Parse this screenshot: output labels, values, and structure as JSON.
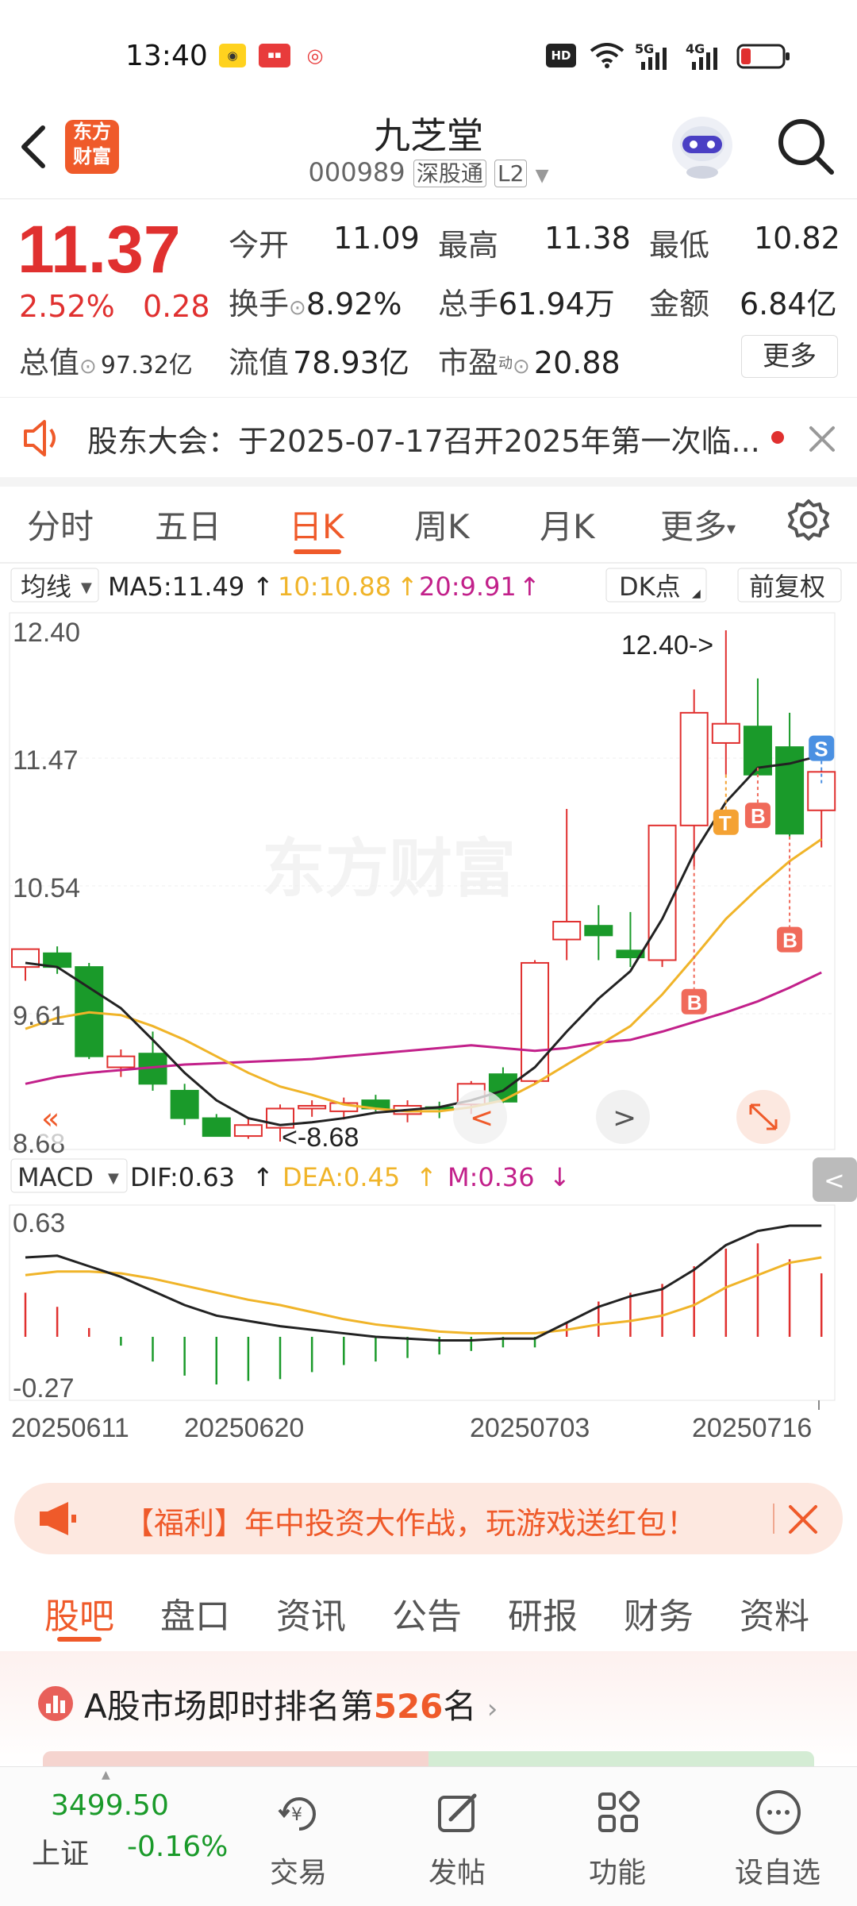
{
  "status_bar": {
    "time": "13:40",
    "network_labels": [
      "HD",
      "5G",
      "4G"
    ]
  },
  "header": {
    "back_icon": "chevron-left-icon",
    "logo_text_line1": "东方",
    "logo_text_line2": "财富",
    "title": "九芝堂",
    "code": "000989",
    "market_tag": "深股通",
    "level_tag": "L2",
    "search_icon": "search-icon"
  },
  "quote": {
    "price": "11.37",
    "change_pct": "2.52%",
    "change_amt": "0.28",
    "open_label": "今开",
    "open": "11.09",
    "high_label": "最高",
    "high": "11.38",
    "low_label": "最低",
    "low": "10.82",
    "turnover_label": "换手",
    "turnover": "8.92%",
    "volume_label": "总手",
    "volume": "61.94万",
    "amount_label": "金额",
    "amount": "6.84亿",
    "total_cap_label": "总值",
    "total_cap": "97.32亿",
    "float_cap_label": "流值",
    "float_cap": "78.93亿",
    "pe_label": "市盈",
    "pe_sup": "动",
    "pe": "20.88",
    "more_label": "更多"
  },
  "notice": {
    "text": "股东大会：于2025-07-17召开2025年第一次临..."
  },
  "chart_tabs": [
    "分时",
    "五日",
    "日K",
    "周K",
    "月K",
    "更多"
  ],
  "chart_tabs_active": 2,
  "chart_controls": {
    "ma_label": "均线",
    "ma5": "MA5:11.49",
    "ma10": "10:10.88",
    "ma20": "20:9.91",
    "dk_label": "DK点",
    "adjust_label": "前复权",
    "macd_label": "MACD",
    "dif": "DIF:0.63",
    "dea": "DEA:0.45",
    "m": "M:0.36"
  },
  "chart_data": {
    "type": "candlestick",
    "y_ticks": [
      "12.40",
      "11.47",
      "10.54",
      "9.61",
      "8.68"
    ],
    "ylim": [
      8.68,
      12.4
    ],
    "x_ticks": [
      "20250611",
      "20250620",
      "20250703",
      "20250716"
    ],
    "high_annotation": "12.40->",
    "low_annotation": "<-8.68",
    "candles": [
      {
        "o": 9.95,
        "h": 10.05,
        "l": 9.85,
        "c": 10.08
      },
      {
        "o": 10.05,
        "h": 10.1,
        "l": 9.9,
        "c": 9.95
      },
      {
        "o": 9.95,
        "h": 9.98,
        "l": 9.28,
        "c": 9.3
      },
      {
        "o": 9.22,
        "h": 9.35,
        "l": 9.15,
        "c": 9.3
      },
      {
        "o": 9.32,
        "h": 9.48,
        "l": 9.05,
        "c": 9.1
      },
      {
        "o": 9.05,
        "h": 9.1,
        "l": 8.8,
        "c": 8.85
      },
      {
        "o": 8.85,
        "h": 8.88,
        "l": 8.72,
        "c": 8.72
      },
      {
        "o": 8.72,
        "h": 8.85,
        "l": 8.7,
        "c": 8.8
      },
      {
        "o": 8.78,
        "h": 8.95,
        "l": 8.68,
        "c": 8.92
      },
      {
        "o": 8.92,
        "h": 8.98,
        "l": 8.86,
        "c": 8.94
      },
      {
        "o": 8.9,
        "h": 9.0,
        "l": 8.84,
        "c": 8.96
      },
      {
        "o": 8.98,
        "h": 9.02,
        "l": 8.9,
        "c": 8.92
      },
      {
        "o": 8.88,
        "h": 8.98,
        "l": 8.82,
        "c": 8.94
      },
      {
        "o": 8.93,
        "h": 8.97,
        "l": 8.85,
        "c": 8.92
      },
      {
        "o": 8.95,
        "h": 9.12,
        "l": 8.88,
        "c": 9.1
      },
      {
        "o": 9.17,
        "h": 9.22,
        "l": 8.96,
        "c": 8.97
      },
      {
        "o": 9.12,
        "h": 10.0,
        "l": 9.1,
        "c": 9.98
      },
      {
        "o": 10.15,
        "h": 11.1,
        "l": 10.0,
        "c": 10.28
      },
      {
        "o": 10.25,
        "h": 10.4,
        "l": 10.0,
        "c": 10.18
      },
      {
        "o": 10.07,
        "h": 10.35,
        "l": 9.95,
        "c": 10.02
      },
      {
        "o": 10.0,
        "h": 10.98,
        "l": 9.95,
        "c": 10.98
      },
      {
        "o": 10.98,
        "h": 11.97,
        "l": 10.68,
        "c": 11.8
      },
      {
        "o": 11.58,
        "h": 12.4,
        "l": 11.35,
        "c": 11.72
      },
      {
        "o": 11.7,
        "h": 12.05,
        "l": 11.4,
        "c": 11.35
      },
      {
        "o": 11.55,
        "h": 11.8,
        "l": 10.9,
        "c": 10.92
      },
      {
        "o": 11.09,
        "h": 11.38,
        "l": 10.82,
        "c": 11.37
      }
    ],
    "ma5": [
      9.98,
      9.95,
      9.8,
      9.65,
      9.42,
      9.18,
      8.98,
      8.85,
      8.8,
      8.82,
      8.85,
      8.89,
      8.91,
      8.93,
      8.98,
      9.05,
      9.22,
      9.48,
      9.72,
      9.92,
      10.3,
      10.78,
      11.15,
      11.4,
      11.43,
      11.49
    ],
    "ma10": [
      9.5,
      9.58,
      9.62,
      9.6,
      9.52,
      9.42,
      9.3,
      9.18,
      9.08,
      9.02,
      8.95,
      8.92,
      8.9,
      8.9,
      8.93,
      8.98,
      9.1,
      9.24,
      9.38,
      9.52,
      9.75,
      10.02,
      10.3,
      10.52,
      10.72,
      10.88
    ],
    "ma20": [
      9.1,
      9.15,
      9.18,
      9.2,
      9.22,
      9.24,
      9.25,
      9.26,
      9.27,
      9.28,
      9.3,
      9.32,
      9.34,
      9.36,
      9.38,
      9.36,
      9.34,
      9.36,
      9.4,
      9.42,
      9.48,
      9.55,
      9.62,
      9.7,
      9.8,
      9.91
    ],
    "markers": [
      {
        "index": 21,
        "label": "B",
        "color": "#f06a5a"
      },
      {
        "index": 22,
        "label": "T",
        "color": "#f4a233"
      },
      {
        "index": 23,
        "label": "B",
        "color": "#f06a5a"
      },
      {
        "index": 24,
        "label": "B",
        "color": "#f06a5a"
      },
      {
        "index": 25,
        "label": "S",
        "color": "#4a90e2"
      }
    ],
    "macd": {
      "y_ticks": [
        "0.63",
        "-0.27"
      ],
      "ylim": [
        -0.27,
        0.63
      ],
      "dif": [
        0.45,
        0.46,
        0.4,
        0.34,
        0.26,
        0.18,
        0.12,
        0.09,
        0.06,
        0.04,
        0.02,
        0.0,
        -0.01,
        -0.02,
        -0.02,
        -0.01,
        -0.01,
        0.08,
        0.17,
        0.23,
        0.27,
        0.38,
        0.52,
        0.6,
        0.63,
        0.63
      ],
      "dea": [
        0.35,
        0.37,
        0.37,
        0.36,
        0.33,
        0.29,
        0.25,
        0.21,
        0.18,
        0.14,
        0.1,
        0.07,
        0.05,
        0.03,
        0.02,
        0.02,
        0.02,
        0.04,
        0.07,
        0.09,
        0.12,
        0.18,
        0.28,
        0.35,
        0.42,
        0.45
      ],
      "hist": [
        0.25,
        0.17,
        0.05,
        -0.05,
        -0.14,
        -0.22,
        -0.27,
        -0.25,
        -0.24,
        -0.2,
        -0.16,
        -0.14,
        -0.12,
        -0.1,
        -0.08,
        -0.06,
        -0.06,
        0.08,
        0.2,
        0.25,
        0.3,
        0.4,
        0.5,
        0.53,
        0.44,
        0.36
      ]
    }
  },
  "banner": {
    "text": "【福利】年中投资大作战，玩游戏送红包！"
  },
  "bottom_tabs": [
    "股吧",
    "盘口",
    "资讯",
    "公告",
    "研报",
    "财务",
    "资料"
  ],
  "bottom_tabs_active": 0,
  "ranking": {
    "prefix": "A股市场即时排名第",
    "rank": "526",
    "suffix": "名"
  },
  "bottom_nav": {
    "index_value": "3499.50",
    "index_name": "上证",
    "index_change": "-0.16%",
    "items": [
      {
        "label": "交易",
        "icon": "trade-icon"
      },
      {
        "label": "发帖",
        "icon": "post-icon"
      },
      {
        "label": "功能",
        "icon": "apps-icon"
      },
      {
        "label": "设自选",
        "icon": "add-watchlist-icon"
      }
    ]
  },
  "colors": {
    "up": "#e0302f",
    "down": "#1a9a2a",
    "ma5": "#222222",
    "ma10": "#f0b429",
    "ma20": "#c2208a",
    "accent": "#ef5a2a"
  }
}
